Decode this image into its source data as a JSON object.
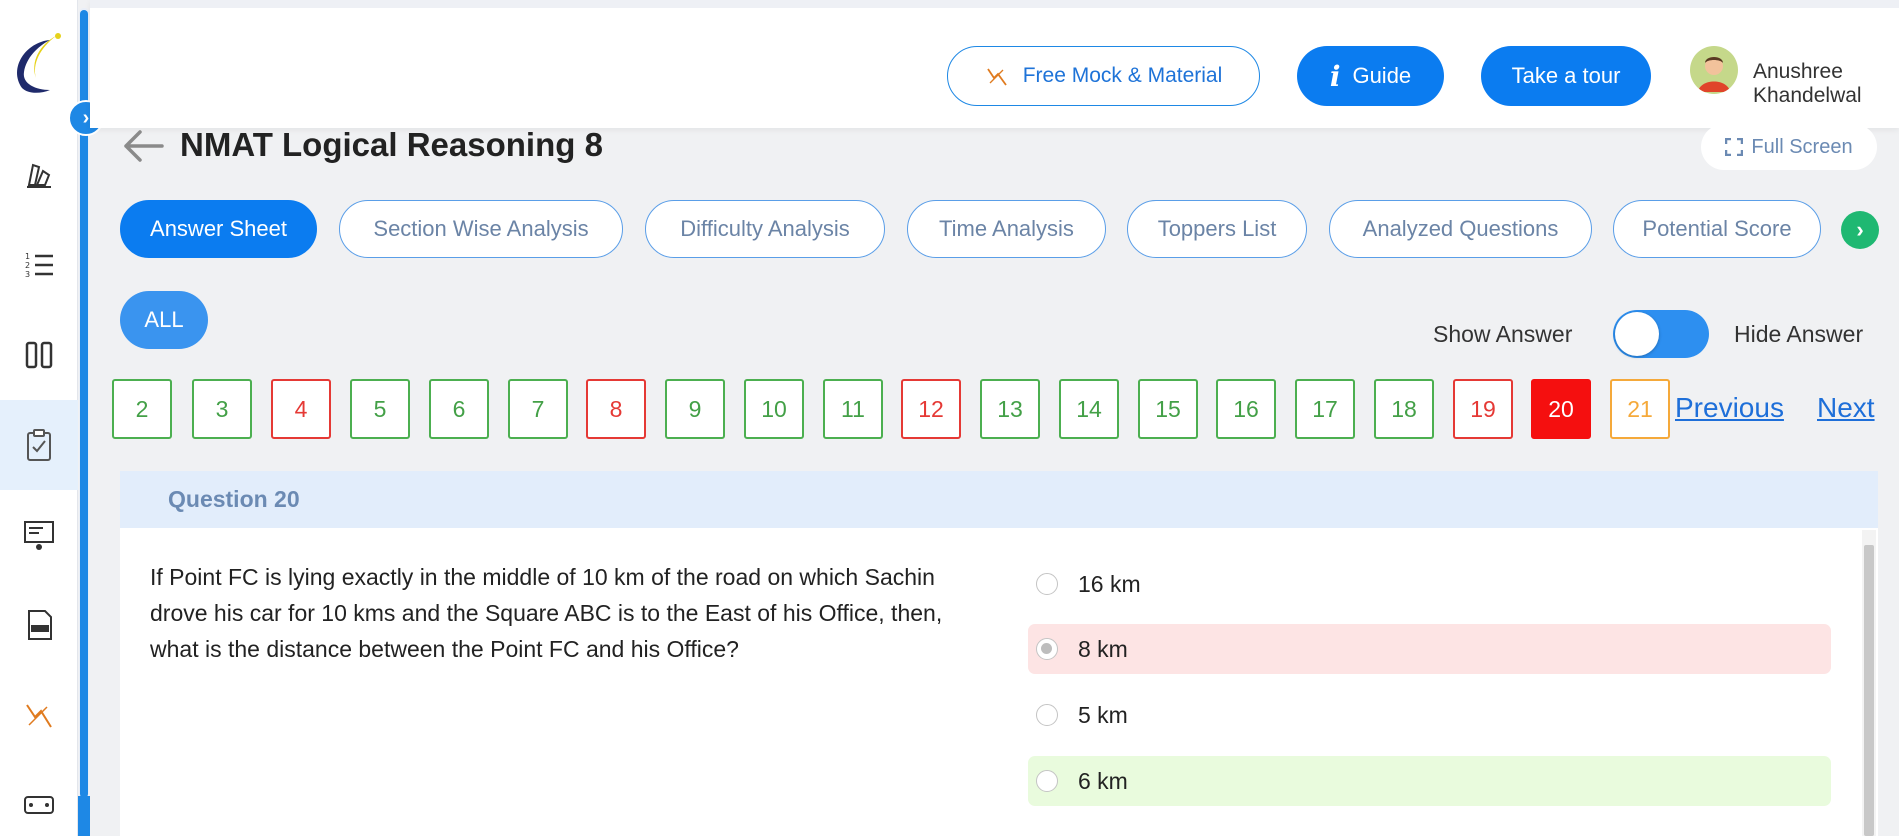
{
  "header": {
    "free_mock_label": "Free Mock & Material",
    "guide_label": "Guide",
    "tour_label": "Take a tour",
    "user_name": "Anushree Khandelwal"
  },
  "page": {
    "title": "NMAT Logical Reasoning 8",
    "full_screen_label": "Full Screen"
  },
  "tabs": [
    {
      "label": "Answer Sheet",
      "active": true
    },
    {
      "label": "Section Wise Analysis"
    },
    {
      "label": "Difficulty Analysis"
    },
    {
      "label": "Time Analysis"
    },
    {
      "label": "Toppers List"
    },
    {
      "label": "Analyzed Questions"
    },
    {
      "label": "Potential Score"
    }
  ],
  "filter": {
    "all_label": "ALL"
  },
  "answer_toggle": {
    "show_label": "Show Answer",
    "hide_label": "Hide Answer"
  },
  "question_numbers": [
    {
      "n": "2",
      "status": "correct"
    },
    {
      "n": "3",
      "status": "correct"
    },
    {
      "n": "4",
      "status": "wrong"
    },
    {
      "n": "5",
      "status": "correct"
    },
    {
      "n": "6",
      "status": "correct"
    },
    {
      "n": "7",
      "status": "correct"
    },
    {
      "n": "8",
      "status": "wrong"
    },
    {
      "n": "9",
      "status": "correct"
    },
    {
      "n": "10",
      "status": "correct"
    },
    {
      "n": "11",
      "status": "correct"
    },
    {
      "n": "12",
      "status": "wrong"
    },
    {
      "n": "13",
      "status": "correct"
    },
    {
      "n": "14",
      "status": "correct"
    },
    {
      "n": "15",
      "status": "correct"
    },
    {
      "n": "16",
      "status": "correct"
    },
    {
      "n": "17",
      "status": "correct"
    },
    {
      "n": "18",
      "status": "correct"
    },
    {
      "n": "19",
      "status": "wrong"
    },
    {
      "n": "20",
      "status": "current"
    },
    {
      "n": "21",
      "status": "skipped"
    }
  ],
  "nav": {
    "previous_label": "Previous",
    "next_label": "Next"
  },
  "question": {
    "label": "Question 20",
    "text": "If Point FC is lying exactly in the middle of 10 km of the road on which Sachin drove his car for 10 kms and the Square ABC is to the East of his Office, then, what is the distance between the Point FC and his Office?",
    "options": [
      {
        "text": "16 km",
        "state": "none"
      },
      {
        "text": "8 km",
        "state": "wrong",
        "selected": true
      },
      {
        "text": "5 km",
        "state": "none"
      },
      {
        "text": "6 km",
        "state": "correct"
      }
    ]
  },
  "sidebar_icons": [
    "logo",
    "practice-icon",
    "list-icon",
    "columns-icon",
    "clipboard-icon",
    "presentation-icon",
    "ebook-icon",
    "mock-icon",
    "ticket-icon"
  ],
  "colors": {
    "primary": "#0b7cf0",
    "correct": "#4caf50",
    "wrong": "#e53935",
    "skipped": "#f5a93a",
    "next_tab": "#1fb872"
  }
}
